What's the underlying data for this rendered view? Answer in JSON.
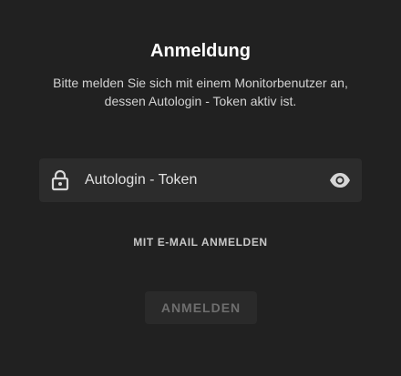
{
  "login": {
    "title": "Anmeldung",
    "subtitle_line1": "Bitte melden Sie sich mit einem Monitorbenutzer an,",
    "subtitle_line2": "dessen Autologin - Token aktiv ist.",
    "token_field": {
      "placeholder": "Autologin - Token",
      "value": "",
      "leading_icon": "lock-icon",
      "trailing_icon": "eye-icon"
    },
    "email_link_label": "MIT E-MAIL ANMELDEN",
    "submit_label": "ANMELDEN",
    "submit_enabled": false
  },
  "colors": {
    "background": "#212121",
    "field_background": "#2c2c2c",
    "title": "#ffffff",
    "subtitle": "#d3d3d3",
    "disabled_button_text": "#6e6e6e"
  }
}
